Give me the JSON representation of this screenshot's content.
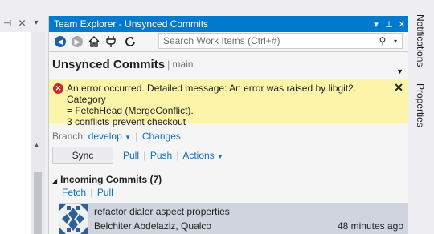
{
  "window": {
    "title": "Team Explorer - Unsynced Commits",
    "title_buttons": [
      "▾",
      "⊥",
      "✕"
    ]
  },
  "left_toolbar": {
    "pin_glyph": "⊣",
    "close_glyph": "✕",
    "dropdown_glyph": "▾"
  },
  "nav": {
    "back_icon": "back-arrow-icon",
    "forward_icon": "forward-arrow-icon",
    "home_icon": "home-icon",
    "connect_icon": "plug-icon",
    "refresh_icon": "refresh-icon"
  },
  "search": {
    "placeholder": "Search Work Items (Ctrl+#)"
  },
  "header": {
    "title": "Unsynced Commits",
    "separator": "|",
    "repo": "main"
  },
  "error": {
    "line1": "An error occurred. Detailed message: An error was raised by libgit2. Category",
    "line2": "= FetchHead (MergeConflict).",
    "line3": "3 conflicts prevent checkout",
    "close_label": "✕"
  },
  "branch": {
    "label": "Branch:",
    "name": "develop",
    "changes_link": "Changes"
  },
  "actions": {
    "sync_label": "Sync",
    "pull_label": "Pull",
    "push_label": "Push",
    "actions_label": "Actions"
  },
  "incoming": {
    "title": "Incoming Commits (7)",
    "fetch_label": "Fetch",
    "pull_label": "Pull",
    "commits": [
      {
        "message": "refactor dialer aspect properties",
        "author": "Belchiter Abdelaziz, Qualco",
        "time": "48 minutes ago"
      }
    ]
  },
  "right_tabs": [
    "Notifications",
    "Properties"
  ],
  "colors": {
    "title_bar": "#007acc",
    "error_background": "#fcf5a9",
    "link": "#0e70c0",
    "selected_row": "#cfd4de"
  }
}
